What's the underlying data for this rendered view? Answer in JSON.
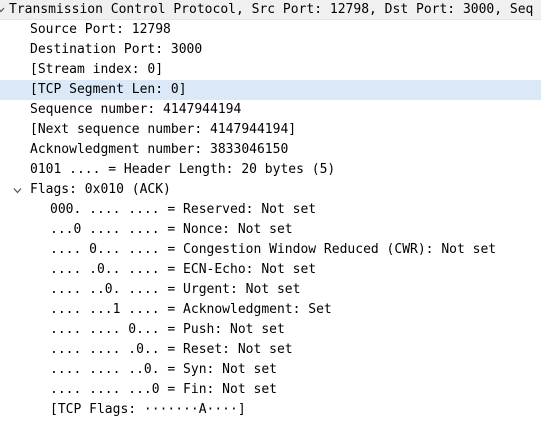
{
  "tree": {
    "header": "Transmission Control Protocol, Src Port: 12798, Dst Port: 3000, Seq",
    "source_port": "Source Port: 12798",
    "destination_port": "Destination Port: 3000",
    "stream_index": "[Stream index: 0]",
    "segment_len": "[TCP Segment Len: 0]",
    "sequence_number": "Sequence number: 4147944194",
    "next_sequence_number": "[Next sequence number: 4147944194]",
    "acknowledgment_number": "Acknowledgment number: 3833046150",
    "header_length": "0101 .... = Header Length: 20 bytes (5)",
    "flags": {
      "label": "Flags: 0x010 (ACK)",
      "items": [
        "000. .... .... = Reserved: Not set",
        "...0 .... .... = Nonce: Not set",
        ".... 0... .... = Congestion Window Reduced (CWR): Not set",
        ".... .0.. .... = ECN-Echo: Not set",
        ".... ..0. .... = Urgent: Not set",
        ".... ...1 .... = Acknowledgment: Set",
        ".... .... 0... = Push: Not set",
        ".... .... .0.. = Reset: Not set",
        ".... .... ..0. = Syn: Not set",
        ".... .... ...0 = Fin: Not set",
        "[TCP Flags: ·······A····]"
      ]
    }
  }
}
